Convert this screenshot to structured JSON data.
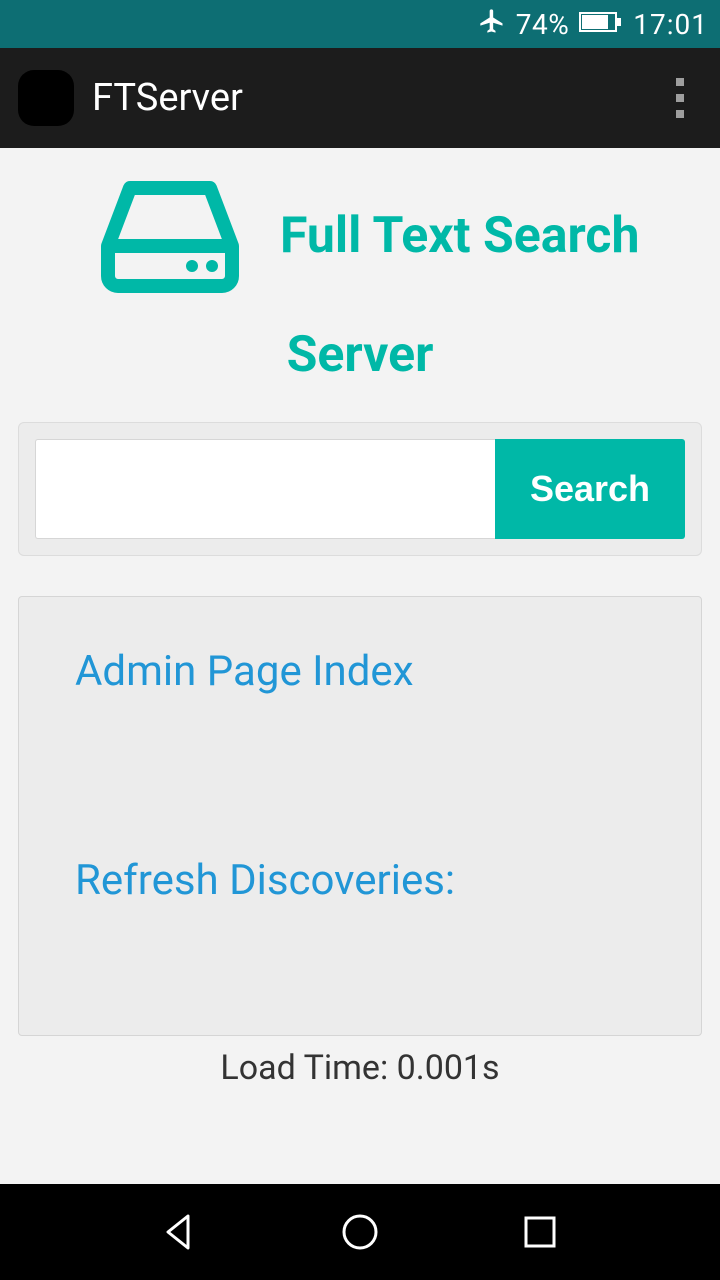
{
  "status_bar": {
    "battery_percent": "74%",
    "time": "17:01"
  },
  "app_bar": {
    "title": "FTServer"
  },
  "hero": {
    "title_line1": "Full Text Search",
    "title_line2": "Server"
  },
  "search": {
    "input_value": "",
    "button_label": "Search"
  },
  "links": {
    "admin_page": "Admin Page Index",
    "refresh_discoveries": "Refresh Discoveries:"
  },
  "footer": {
    "load_time": "Load Time: 0.001s"
  }
}
